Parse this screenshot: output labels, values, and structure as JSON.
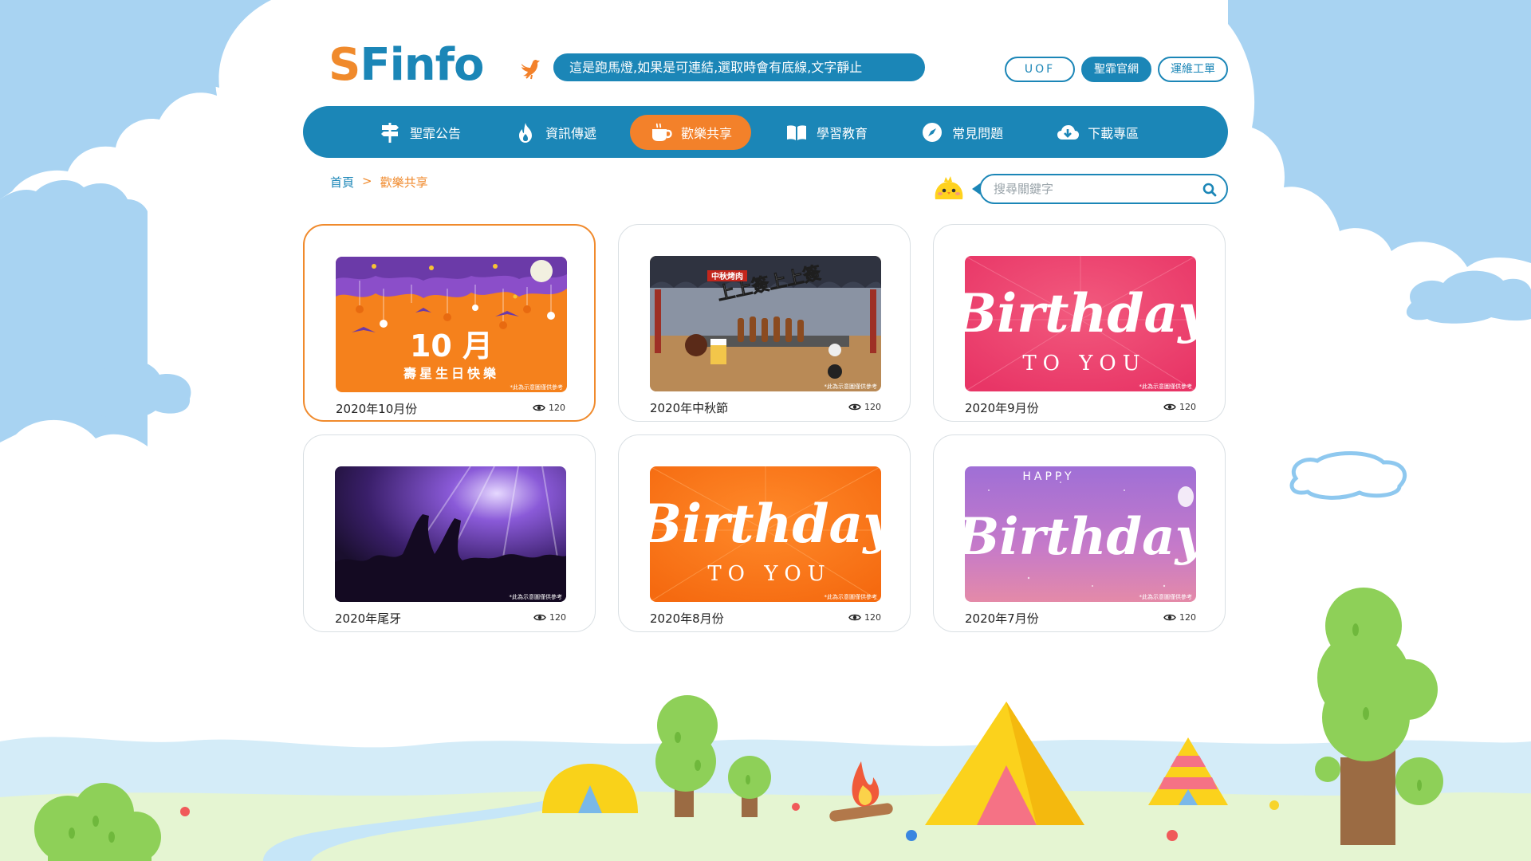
{
  "logo": {
    "first": "S",
    "rest": "Finfo"
  },
  "marquee": {
    "text": "這是跑馬燈,如果是可連結,選取時會有底線,文字靜止"
  },
  "top_links": [
    "UOF",
    "聖霏官網",
    "運維工單"
  ],
  "nav": [
    {
      "label": "聖霏公告",
      "icon": "signpost-icon"
    },
    {
      "label": "資訊傳遞",
      "icon": "flame-icon"
    },
    {
      "label": "歡樂共享",
      "icon": "coffee-icon"
    },
    {
      "label": "學習教育",
      "icon": "book-icon"
    },
    {
      "label": "常見問題",
      "icon": "compass-icon"
    },
    {
      "label": "下載專區",
      "icon": "cloud-download-icon"
    }
  ],
  "nav_active": 2,
  "breadcrumb": {
    "home": "首頁",
    "sep": ">",
    "current": "歡樂共享"
  },
  "search": {
    "placeholder": "搜尋關鍵字"
  },
  "cards": [
    {
      "title": "2020年10月份",
      "views": "120",
      "image": "halloween-banner",
      "caption_big": "10 月",
      "caption_small": "壽星生日快樂",
      "note": "*此為示意圖僅供參考"
    },
    {
      "title": "2020年中秋節",
      "views": "120",
      "image": "bbq-banner",
      "caption_big": "上上簽上上簽",
      "caption_small": "中秋烤肉",
      "note": "*此為示意圖僅供參考"
    },
    {
      "title": "2020年9月份",
      "views": "120",
      "image": "birthday-pink-banner",
      "caption_big": "Birthday",
      "caption_small": "TO YOU",
      "note": "*此為示意圖僅供參考"
    },
    {
      "title": "2020年尾牙",
      "views": "120",
      "image": "concert-banner",
      "note": "*此為示意圖僅供參考"
    },
    {
      "title": "2020年8月份",
      "views": "120",
      "image": "birthday-orange-banner",
      "caption_big": "Birthday",
      "caption_small": "TO YOU",
      "note": "*此為示意圖僅供參考"
    },
    {
      "title": "2020年7月份",
      "views": "120",
      "image": "birthday-purple-banner",
      "caption_top": "HAPPY",
      "caption_big": "Birthday",
      "note": "*此為示意圖僅供參考"
    }
  ],
  "selected_card": 0,
  "colors": {
    "primary": "#1b86b7",
    "accent": "#f3812a",
    "sky": "#a8d3f2",
    "grass": "#e5f5d2"
  }
}
